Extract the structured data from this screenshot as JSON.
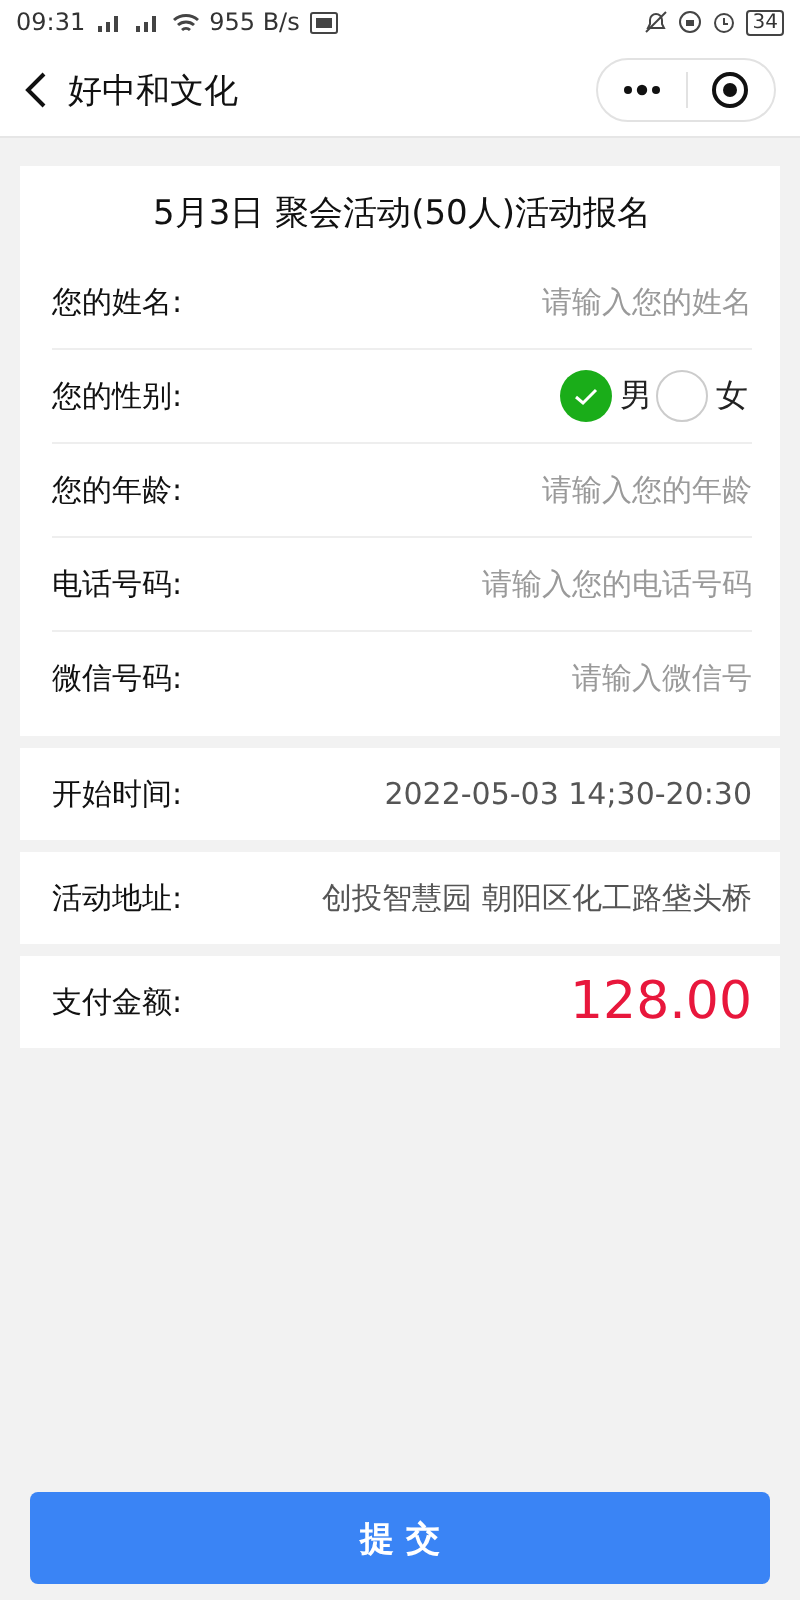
{
  "status_bar": {
    "time": "09:31",
    "speed": "955 B/s",
    "battery": "34"
  },
  "nav": {
    "title": "好中和文化"
  },
  "form": {
    "title": "5月3日 聚会活动(50人)活动报名",
    "fields": [
      {
        "kind": "input",
        "label": "您的姓名:",
        "placeholder": "请输入您的姓名"
      },
      {
        "kind": "radio",
        "label": "您的性别:",
        "options": [
          {
            "label": "男",
            "selected": true
          },
          {
            "label": "女",
            "selected": false
          }
        ]
      },
      {
        "kind": "input",
        "label": "您的年龄:",
        "placeholder": "请输入您的年龄"
      },
      {
        "kind": "input",
        "label": "电话号码:",
        "placeholder": "请输入您的电话号码"
      },
      {
        "kind": "input",
        "label": "微信号码:",
        "placeholder": "请输入微信号"
      }
    ]
  },
  "info": [
    {
      "kind": "text",
      "label": "开始时间:",
      "value": "2022-05-03  14;30-20:30"
    },
    {
      "kind": "text",
      "label": "活动地址:",
      "value": "创投智慧园 朝阳区化工路垡头桥"
    },
    {
      "kind": "price",
      "label": "支付金额:",
      "value": "128.00"
    }
  ],
  "submit": "提 交"
}
